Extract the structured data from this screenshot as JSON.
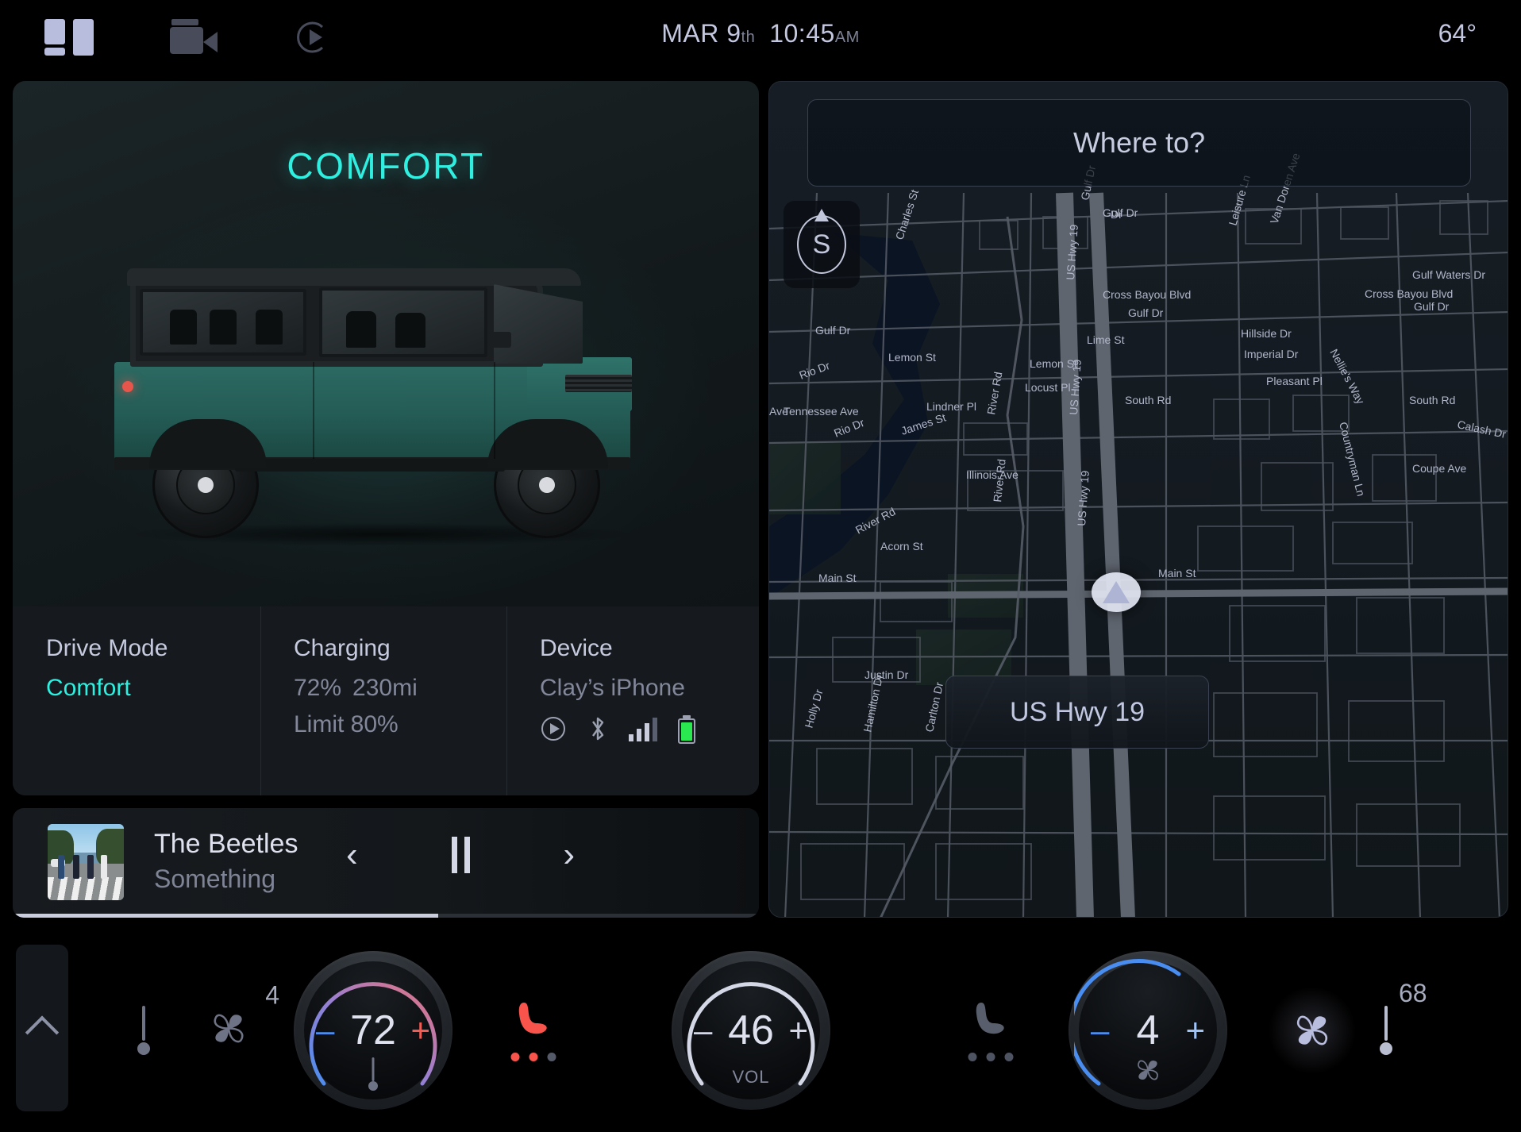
{
  "statusbar": {
    "icons": [
      "layout-icon",
      "video-camera-icon",
      "play-circle-icon"
    ],
    "date": "MAR 9",
    "date_suffix": "th",
    "time": "10:45",
    "time_suffix": "AM",
    "outside_temp": "64°"
  },
  "vehicle_card": {
    "drive_mode_title": "COMFORT",
    "range_value": "230",
    "range_unit": "mi",
    "range_percent": 72,
    "info": [
      {
        "label": "Drive Mode",
        "value": "Comfort"
      },
      {
        "label": "Charging",
        "line1_a": "72%",
        "line1_b": "230mi",
        "line2": "Limit 80%"
      },
      {
        "label": "Device",
        "value": "Clay’s iPhone",
        "icons": [
          "play-circle-icon",
          "bluetooth-icon",
          "signal-bars-icon",
          "battery-icon"
        ],
        "signal_bars_filled": 3,
        "signal_bars_total": 4,
        "battery_level": 82,
        "battery_color": "#2ae84f"
      }
    ]
  },
  "media": {
    "artist": "The Beetles",
    "song": "Something",
    "album_art": "abbey-road-cover",
    "prev_label": "‹",
    "next_label": "›",
    "playback_state": "playing",
    "progress_percent": 57
  },
  "map": {
    "search_placeholder": "Where to?",
    "compass_heading": "S",
    "current_road": "US Hwy 19",
    "labels": [
      "Gulf Dr",
      "Gulf Dr",
      "Gulf Dr",
      "Lemon St",
      "Lemon St",
      "Lime St",
      "Locust Pl",
      "Lindner Pl",
      "James St",
      "Rio Dr",
      "Rio Dr",
      "Tennessee Ave",
      "River Rd",
      "River Rd",
      "River Rd",
      "Illinois Ave",
      "Acorn St",
      "Main St",
      "Main St",
      "Justin Dr",
      "Charles St",
      "US Hwy 19",
      "US Hwy 19",
      "US Hwy 19",
      "Cross Bayou Blvd",
      "Cross Bayou Blvd",
      "Gulf Waters Dr",
      "Van Doren Ave",
      "Leisure Ln",
      "Hillside Dr",
      "Imperial Dr",
      "Nellie's Way",
      "Pleasant Pl",
      "South Rd",
      "South Rd",
      "Calash Dr",
      "Countryman Ln",
      "Coupe Ave"
    ]
  },
  "climate": {
    "expand_label": "expand-chevron",
    "driver": {
      "fan_level": "4",
      "temperature": "72",
      "minus": "–",
      "plus": "+",
      "seat_heat_level": 2,
      "seat_heat_total": 3,
      "seat_heat_color": "#f9544c",
      "temp_icon_active": false
    },
    "volume": {
      "value": "46",
      "label": "VOL",
      "minus": "–",
      "plus": "+"
    },
    "passenger": {
      "fan_level": "4",
      "temperature": "68",
      "minus": "–",
      "plus": "+",
      "seat_heat_level": 0,
      "seat_heat_total": 3,
      "fan_icon_active": true
    }
  },
  "colors": {
    "accent_cyan": "#2ff0e0",
    "battery_green": "#2ae84f",
    "seat_heat_red": "#f9544c",
    "cool_blue": "#4a8df0",
    "warm_red": "#e8554a",
    "text_primary": "#dfe2ee",
    "text_muted": "#82879a"
  }
}
